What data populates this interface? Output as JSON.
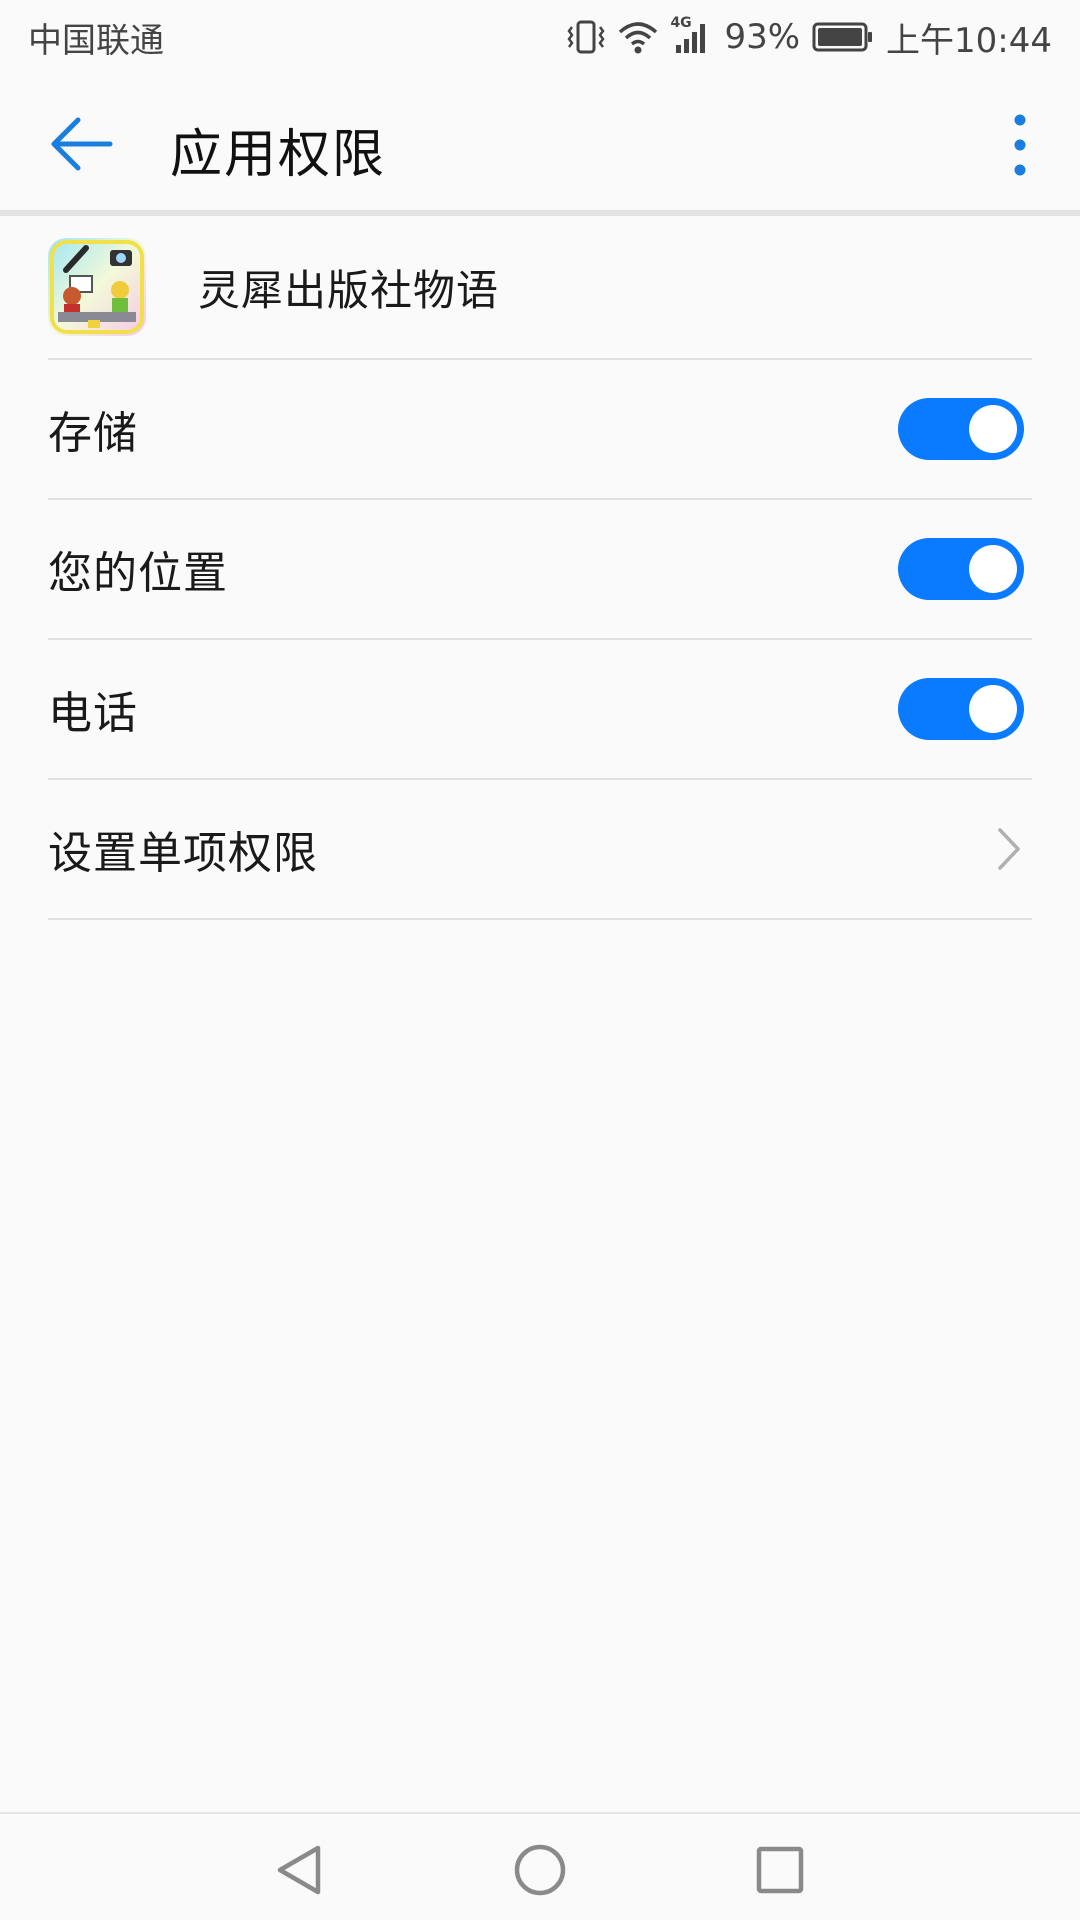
{
  "status_bar": {
    "carrier": "中国联通",
    "network": "4G",
    "battery": "93%",
    "time": "上午10:44",
    "icons": [
      "vibrate-icon",
      "wifi-icon",
      "signal-icon",
      "battery-icon"
    ]
  },
  "app_bar": {
    "title": "应用权限",
    "back_icon": "arrow-left-icon",
    "more_icon": "more-vert-icon"
  },
  "app": {
    "name": "灵犀出版社物语",
    "icon": "app-icon"
  },
  "permissions": [
    {
      "label": "存储",
      "enabled": true
    },
    {
      "label": "您的位置",
      "enabled": true
    },
    {
      "label": "电话",
      "enabled": true
    }
  ],
  "individual_permissions": {
    "label": "设置单项权限",
    "icon": "chevron-right-icon"
  },
  "nav_bar": {
    "icons": [
      "back-triangle-icon",
      "home-circle-icon",
      "recents-square-icon"
    ]
  },
  "colors": {
    "accent": "#0a7bff",
    "background": "#fafafa",
    "divider": "#e2e2e2"
  }
}
